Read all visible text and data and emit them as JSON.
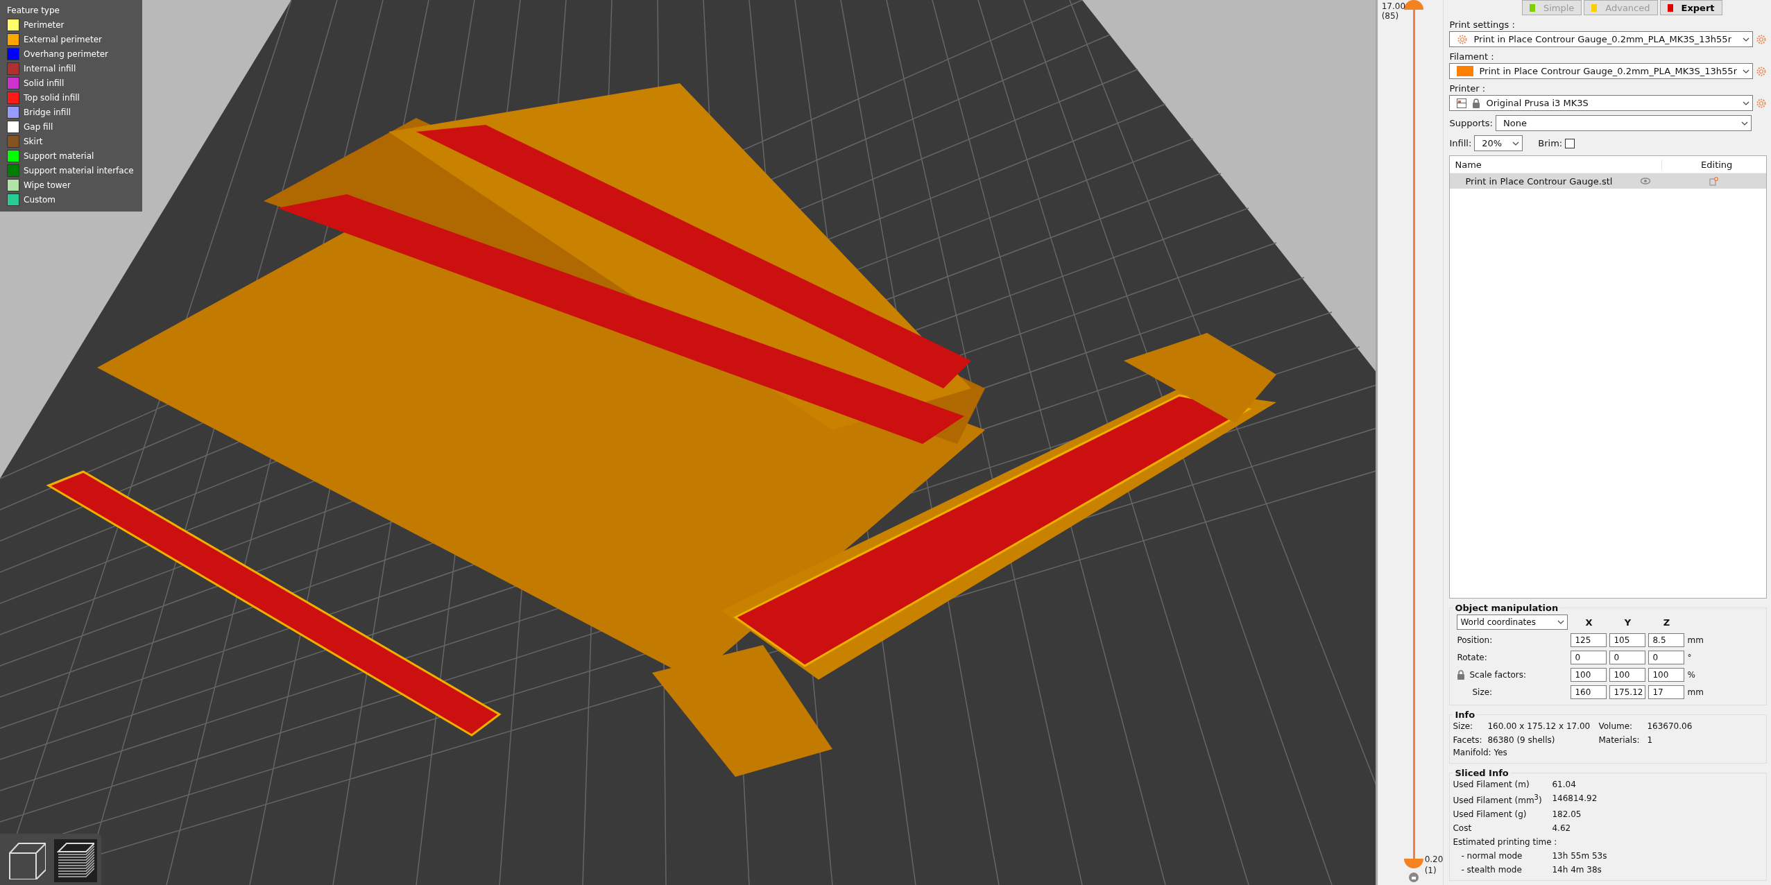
{
  "legend": {
    "title": "Feature type",
    "items": [
      {
        "label": "Perimeter",
        "color": "#ffff68"
      },
      {
        "label": "External perimeter",
        "color": "#ffa500"
      },
      {
        "label": "Overhang perimeter",
        "color": "#0000ff"
      },
      {
        "label": "Internal infill",
        "color": "#b03030"
      },
      {
        "label": "Solid infill",
        "color": "#d030d0"
      },
      {
        "label": "Top solid infill",
        "color": "#ff1a1a"
      },
      {
        "label": "Bridge infill",
        "color": "#9999ff"
      },
      {
        "label": "Gap fill",
        "color": "#ffffff"
      },
      {
        "label": "Skirt",
        "color": "#845321"
      },
      {
        "label": "Support material",
        "color": "#00ff00"
      },
      {
        "label": "Support material interface",
        "color": "#008000"
      },
      {
        "label": "Wipe tower",
        "color": "#b3e3ab"
      },
      {
        "label": "Custom",
        "color": "#28cc94"
      }
    ]
  },
  "view_toggle": [
    {
      "kind": "model",
      "selected": false
    },
    {
      "kind": "layers",
      "selected": true
    }
  ],
  "layer_slider": {
    "upper_value": "17.00",
    "upper_layer": "(85)",
    "lower_value": "0.20",
    "lower_layer": "(1)"
  },
  "modes": [
    {
      "label": "Simple",
      "color": "#7fd000",
      "selected": false
    },
    {
      "label": "Advanced",
      "color": "#ffd000",
      "selected": false
    },
    {
      "label": "Expert",
      "color": "#e00000",
      "selected": true
    }
  ],
  "presets": [
    {
      "kind": "print",
      "label": "Print settings :",
      "value": "Print in Place Controur Gauge_0.2mm_PLA_MK3S_13h55r"
    },
    {
      "kind": "filament",
      "label": "Filament :",
      "value": "Print in Place Controur Gauge_0.2mm_PLA_MK3S_13h55r",
      "color": "#ff8000"
    },
    {
      "kind": "printer",
      "label": "Printer :",
      "value": "Original Prusa i3 MK3S"
    }
  ],
  "supports": {
    "label": "Supports:",
    "value": "None"
  },
  "infill": {
    "label": "Infill:",
    "value": "20%"
  },
  "brim": {
    "label": "Brim:",
    "checked": false
  },
  "object_list": {
    "columns": [
      "Name",
      "Editing"
    ],
    "rows": [
      {
        "name": "Print in Place Controur Gauge.stl",
        "selected": true
      }
    ]
  },
  "object_manipulation": {
    "title": "Object manipulation",
    "coordinates": "World coordinates",
    "axes": [
      "X",
      "Y",
      "Z"
    ],
    "rows": [
      {
        "label": "Position:",
        "values": [
          "125",
          "105",
          "8.5"
        ],
        "unit": "mm",
        "locked": false
      },
      {
        "label": "Rotate:",
        "values": [
          "0",
          "0",
          "0"
        ],
        "unit": "°",
        "locked": false
      },
      {
        "label": "Scale factors:",
        "values": [
          "100",
          "100",
          "100"
        ],
        "unit": "%",
        "locked": true
      },
      {
        "label": "Size:",
        "values": [
          "160",
          "175.12",
          "17"
        ],
        "unit": "mm",
        "locked": false
      }
    ]
  },
  "info": {
    "title": "Info",
    "items": [
      {
        "label": "Size:",
        "value": "160.00 x 175.12 x 17.00"
      },
      {
        "label": "Volume:",
        "value": "163670.06"
      },
      {
        "label": "Facets:",
        "value": "86380 (9 shells)"
      },
      {
        "label": "Materials:",
        "value": "1"
      }
    ],
    "manifold": "Manifold: Yes"
  },
  "sliced_info": {
    "title": "Sliced Info",
    "rows": [
      {
        "label": "Used Filament (m)",
        "value": "61.04"
      },
      {
        "label": "Used Filament (mm$^{3}$)",
        "value": "146814.92"
      },
      {
        "label": "Used Filament (g)",
        "value": "182.05"
      },
      {
        "label": "Cost",
        "value": "4.62"
      }
    ],
    "time_label": "Estimated printing time :",
    "times": [
      {
        "label": "- normal mode",
        "value": "13h 55m 53s"
      },
      {
        "label": "- stealth mode",
        "value": "14h 4m 38s"
      }
    ]
  }
}
